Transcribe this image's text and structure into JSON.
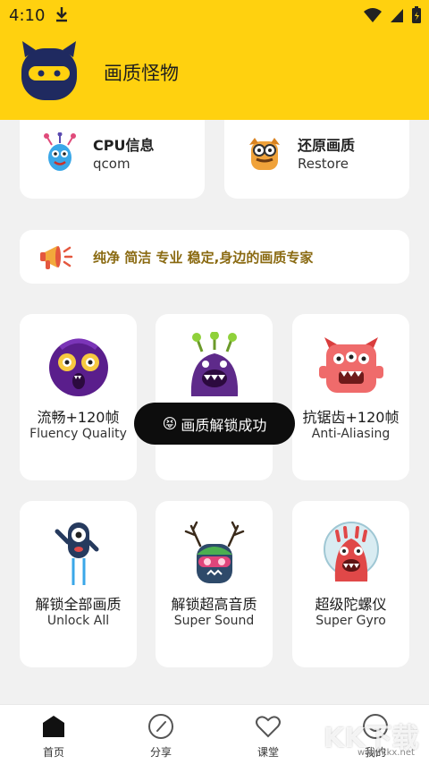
{
  "status": {
    "time": "4:10"
  },
  "app": {
    "title": "画质怪物"
  },
  "top_cards": [
    {
      "title": "CPU信息",
      "subtitle": "qcom"
    },
    {
      "title": "还原画质",
      "subtitle": "Restore"
    }
  ],
  "banner": {
    "text": "纯净 简洁 专业 稳定,身边的画质专家"
  },
  "tiles": [
    {
      "zh": "流畅+120帧",
      "en": "Fluency Quality"
    },
    {
      "zh": "",
      "en": ""
    },
    {
      "zh": "抗锯齿+120帧",
      "en": "Anti-Aliasing"
    },
    {
      "zh": "解锁全部画质",
      "en": "Unlock All"
    },
    {
      "zh": "解锁超高音质",
      "en": "Super Sound"
    },
    {
      "zh": "超级陀螺仪",
      "en": "Super Gyro"
    }
  ],
  "toast": {
    "emoji": "😝",
    "text": "画质解锁成功"
  },
  "nav": [
    {
      "label": "首页"
    },
    {
      "label": "分享"
    },
    {
      "label": "课堂"
    },
    {
      "label": "我的"
    }
  ],
  "watermark": {
    "text": "KK下载",
    "url": "www.kkx.net"
  },
  "colors": {
    "brand_yellow": "#FFD10F",
    "banner_text": "#8a6a12"
  }
}
